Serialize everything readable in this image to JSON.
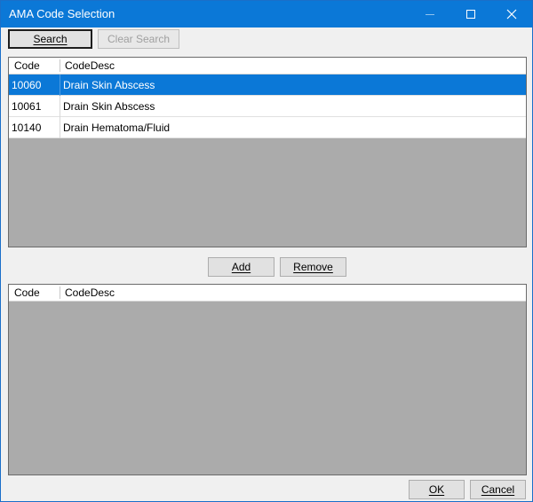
{
  "window": {
    "title": "AMA Code Selection",
    "controls": {
      "minimize_icon": "minimize-icon",
      "maximize_icon": "maximize-icon",
      "close_icon": "close-icon"
    }
  },
  "toolbar": {
    "search_label": "Search",
    "clear_search_label": "Clear Search"
  },
  "results_grid": {
    "columns": [
      "Code",
      "CodeDesc"
    ],
    "rows": [
      {
        "code": "10060",
        "desc": "Drain Skin Abscess",
        "selected": true
      },
      {
        "code": "10061",
        "desc": "Drain Skin Abscess",
        "selected": false
      },
      {
        "code": "10140",
        "desc": "Drain Hematoma/Fluid",
        "selected": false
      }
    ]
  },
  "middle_buttons": {
    "add_label": "Add",
    "remove_label": "Remove"
  },
  "selected_grid": {
    "columns": [
      "Code",
      "CodeDesc"
    ],
    "rows": []
  },
  "footer": {
    "ok_label": "OK",
    "cancel_label": "Cancel"
  },
  "colors": {
    "titlebar": "#0b78d7",
    "selection": "#0b78d7",
    "grid_background": "#ababab"
  }
}
